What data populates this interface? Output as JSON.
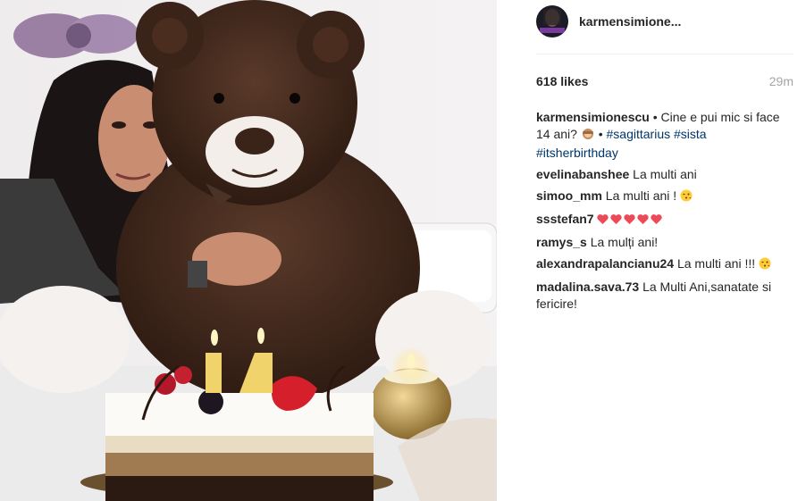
{
  "post": {
    "username": "karmensimione...",
    "avatar_text": "CARMEN",
    "likes": "618 likes",
    "time": "29m",
    "caption": {
      "user": "karmensimionescu",
      "text": " • Cine e pui mic si face 14 ani? ",
      "bullet": " • ",
      "tags": [
        "#sagittarius",
        "#sista",
        "#itsherbirthday"
      ]
    },
    "comments": [
      {
        "user": "evelinabanshee",
        "text": " La multi ani"
      },
      {
        "user": "simoo_mm",
        "text": " La multi ani ! ",
        "emoji": "kiss-face"
      },
      {
        "user": "ssstefan7",
        "text": " ",
        "emoji": "hearts"
      },
      {
        "user": "ramys_s",
        "text": " La mulți ani!"
      },
      {
        "user": "alexandrapalancianu24",
        "text": " La multi ani !!! ",
        "emoji": "kiss-face"
      },
      {
        "user": "madalina.sava.73",
        "text": " La Multi Ani,sanatate si fericire!"
      }
    ],
    "photo": {
      "candle_digits": "14"
    }
  },
  "colors": {
    "tag": "#003569",
    "username": "#262626",
    "time": "#a5a5a5",
    "heart": "#ed4956"
  }
}
